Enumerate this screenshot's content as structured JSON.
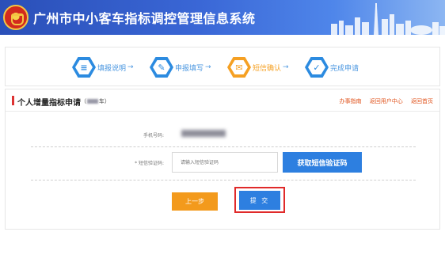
{
  "header": {
    "title": "广州市中小客车指标调控管理信息系统"
  },
  "steps": [
    {
      "label": "填报说明",
      "arrow": "→",
      "icon": "list-icon",
      "glyph": "≡"
    },
    {
      "label": "申报填写",
      "arrow": "→",
      "icon": "edit-icon",
      "glyph": "✎"
    },
    {
      "label": "短信确认",
      "arrow": "→",
      "icon": "phone-sms-icon",
      "glyph": "✉"
    },
    {
      "label": "完成申请",
      "arrow": "",
      "icon": "check-icon",
      "glyph": "✓"
    }
  ],
  "active_step": 2,
  "form": {
    "title": "个人增量指标申请",
    "subtitle_open": "（",
    "subtitle_close": "车）",
    "links": [
      "办事指南",
      "返回用户中心",
      "返回首页"
    ],
    "phone_label": "手机号码:",
    "code_label": "* 短信验证码:",
    "code_placeholder": "请输入短信验证码",
    "get_code_button": "获取短信验证码",
    "prev_button": "上一步",
    "submit_button": "提 交"
  },
  "colors": {
    "header_blue": "#2a4fb8",
    "step_blue": "#2c8be0",
    "step_orange": "#f5a023",
    "button_blue": "#2d7fe0",
    "button_orange": "#f39a1c",
    "highlight_red": "#e02a2a"
  }
}
